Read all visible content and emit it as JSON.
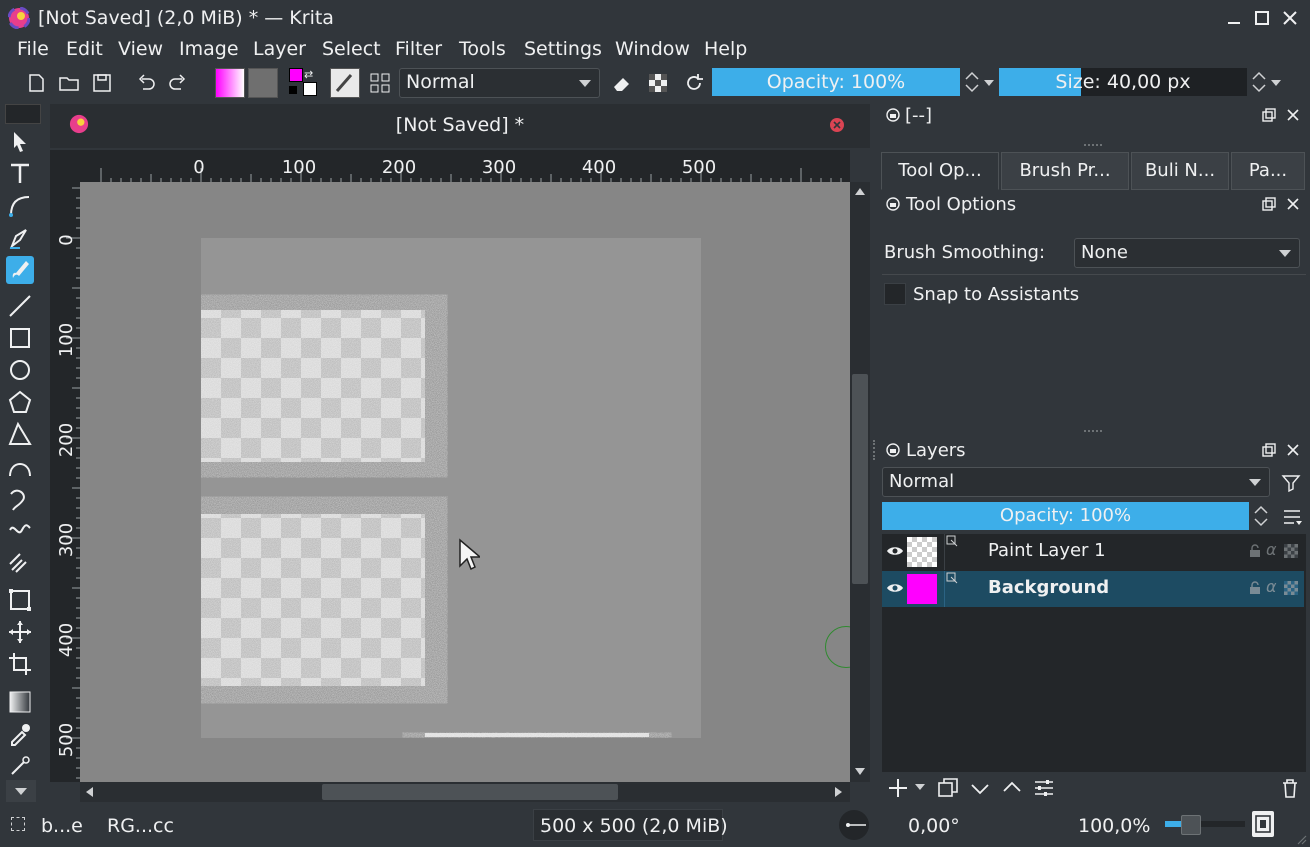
{
  "window": {
    "title": "[Not Saved] (2,0 MiB) * — Krita"
  },
  "menu": [
    "File",
    "Edit",
    "View",
    "Image",
    "Layer",
    "Select",
    "Filter",
    "Tools",
    "Settings",
    "Window",
    "Help"
  ],
  "toolbar": {
    "blend_mode": "Normal",
    "opacity_label": "Opacity: 100%",
    "opacity_value": 1.0,
    "size_label": "Size: 40,00 px",
    "colors": {
      "foreground": "#ff00ff",
      "background": "#ffffff",
      "accent": "#3daee9"
    }
  },
  "document": {
    "tab_title": "[Not Saved]  *",
    "ruler_h": [
      "0",
      "100",
      "200",
      "300",
      "400",
      "500"
    ],
    "ruler_v": [
      "0",
      "100",
      "200",
      "300",
      "400",
      "500"
    ]
  },
  "dock_top": {
    "header": "[--]",
    "tabs": [
      "Tool Op...",
      "Brush Pr...",
      "Buli N...",
      "Pa..."
    ],
    "tool_options_title": "Tool Options",
    "brush_smoothing_label": "Brush Smoothing:",
    "brush_smoothing_value": "None",
    "snap_label": "Snap to Assistants"
  },
  "layers": {
    "title": "Layers",
    "blend_mode": "Normal",
    "opacity_label": "Opacity:  100%",
    "items": [
      {
        "name": "Paint Layer 1",
        "thumb": "transparent"
      },
      {
        "name": "Background",
        "thumb": "#ff00ff",
        "selected": true
      }
    ]
  },
  "status": {
    "brush": "b...e",
    "color_space": "RG...cc",
    "image_size": "500 x 500 (2,0 MiB)",
    "rotation": "0,00°",
    "zoom": "100,0%"
  }
}
